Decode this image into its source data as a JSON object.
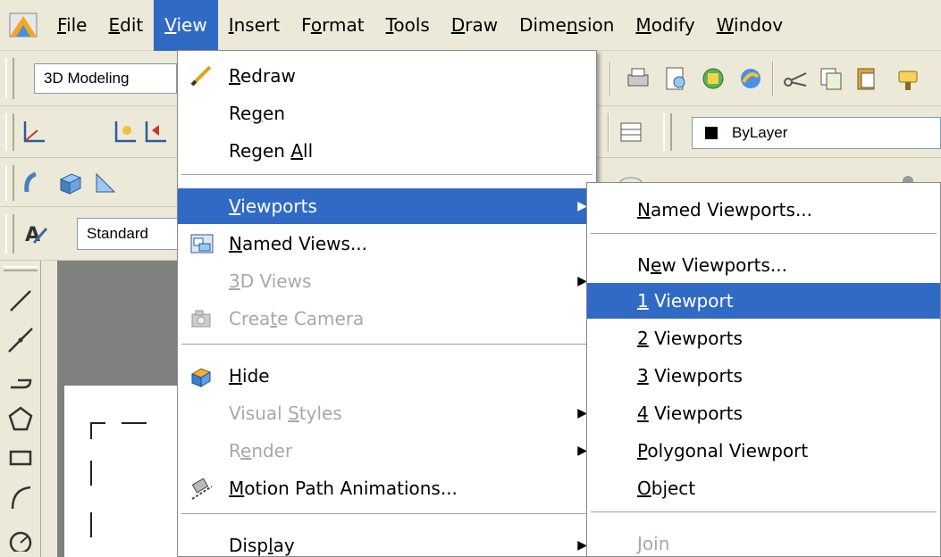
{
  "menubar": {
    "items": [
      {
        "before": "",
        "key": "F",
        "after": "ile"
      },
      {
        "before": "",
        "key": "E",
        "after": "dit"
      },
      {
        "before": "",
        "key": "V",
        "after": "iew"
      },
      {
        "before": "",
        "key": "I",
        "after": "nsert"
      },
      {
        "before": "F",
        "key": "o",
        "after": "rmat"
      },
      {
        "before": "",
        "key": "T",
        "after": "ools"
      },
      {
        "before": "",
        "key": "D",
        "after": "raw"
      },
      {
        "before": "Dime",
        "key": "n",
        "after": "sion"
      },
      {
        "before": "",
        "key": "M",
        "after": "odify"
      },
      {
        "before": "",
        "key": "W",
        "after": "indov"
      }
    ]
  },
  "toolbars": {
    "workspace_label": "3D Modeling",
    "text_style_label": "Standard",
    "layer_label": "ByLayer"
  },
  "view_menu": {
    "items": [
      {
        "before": "",
        "key": "R",
        "after": "edraw",
        "icon": "redraw-pencil-icon"
      },
      {
        "before": "Re",
        "key": "g",
        "after": "en"
      },
      {
        "before": "Regen ",
        "key": "A",
        "after": "ll"
      },
      {
        "before": "",
        "key": "V",
        "after": "iewports",
        "submenu": true,
        "highlight": true
      },
      {
        "before": "",
        "key": "N",
        "after": "amed Views...",
        "icon": "named-views-icon"
      },
      {
        "before": "",
        "key": "3",
        "after": "D Views",
        "submenu": true,
        "disabled": true
      },
      {
        "before": "Crea",
        "key": "t",
        "after": "e Camera",
        "disabled": true,
        "icon": "camera-icon"
      },
      {
        "before": "",
        "key": "H",
        "after": "ide",
        "icon": "hide-icon"
      },
      {
        "before": "Visual ",
        "key": "S",
        "after": "tyles",
        "submenu": true,
        "disabled": true
      },
      {
        "before": "R",
        "key": "e",
        "after": "nder",
        "submenu": true,
        "disabled": true
      },
      {
        "before": "",
        "key": "M",
        "after": "otion Path Animations...",
        "icon": "motion-path-icon"
      },
      {
        "before": "Disp",
        "key": "l",
        "after": "ay",
        "submenu": true
      }
    ]
  },
  "viewports_submenu": {
    "items": [
      {
        "before": "",
        "key": "N",
        "after": "amed Viewports..."
      },
      {
        "before": "N",
        "key": "e",
        "after": "w Viewports..."
      },
      {
        "before": "",
        "key": "1",
        "after": " Viewport",
        "highlight": true
      },
      {
        "before": "",
        "key": "2",
        "after": " Viewports"
      },
      {
        "before": "",
        "key": "3",
        "after": " Viewports"
      },
      {
        "before": "",
        "key": "4",
        "after": " Viewports"
      },
      {
        "before": "",
        "key": "P",
        "after": "olygonal Viewport"
      },
      {
        "before": "",
        "key": "O",
        "after": "bject"
      },
      {
        "before": "",
        "key": "J",
        "after": "oin",
        "disabled": true
      }
    ]
  },
  "colors": {
    "highlight": "#316ac5",
    "menu_bg": "#ece9d8",
    "disabled_text": "#a8a8a8"
  }
}
